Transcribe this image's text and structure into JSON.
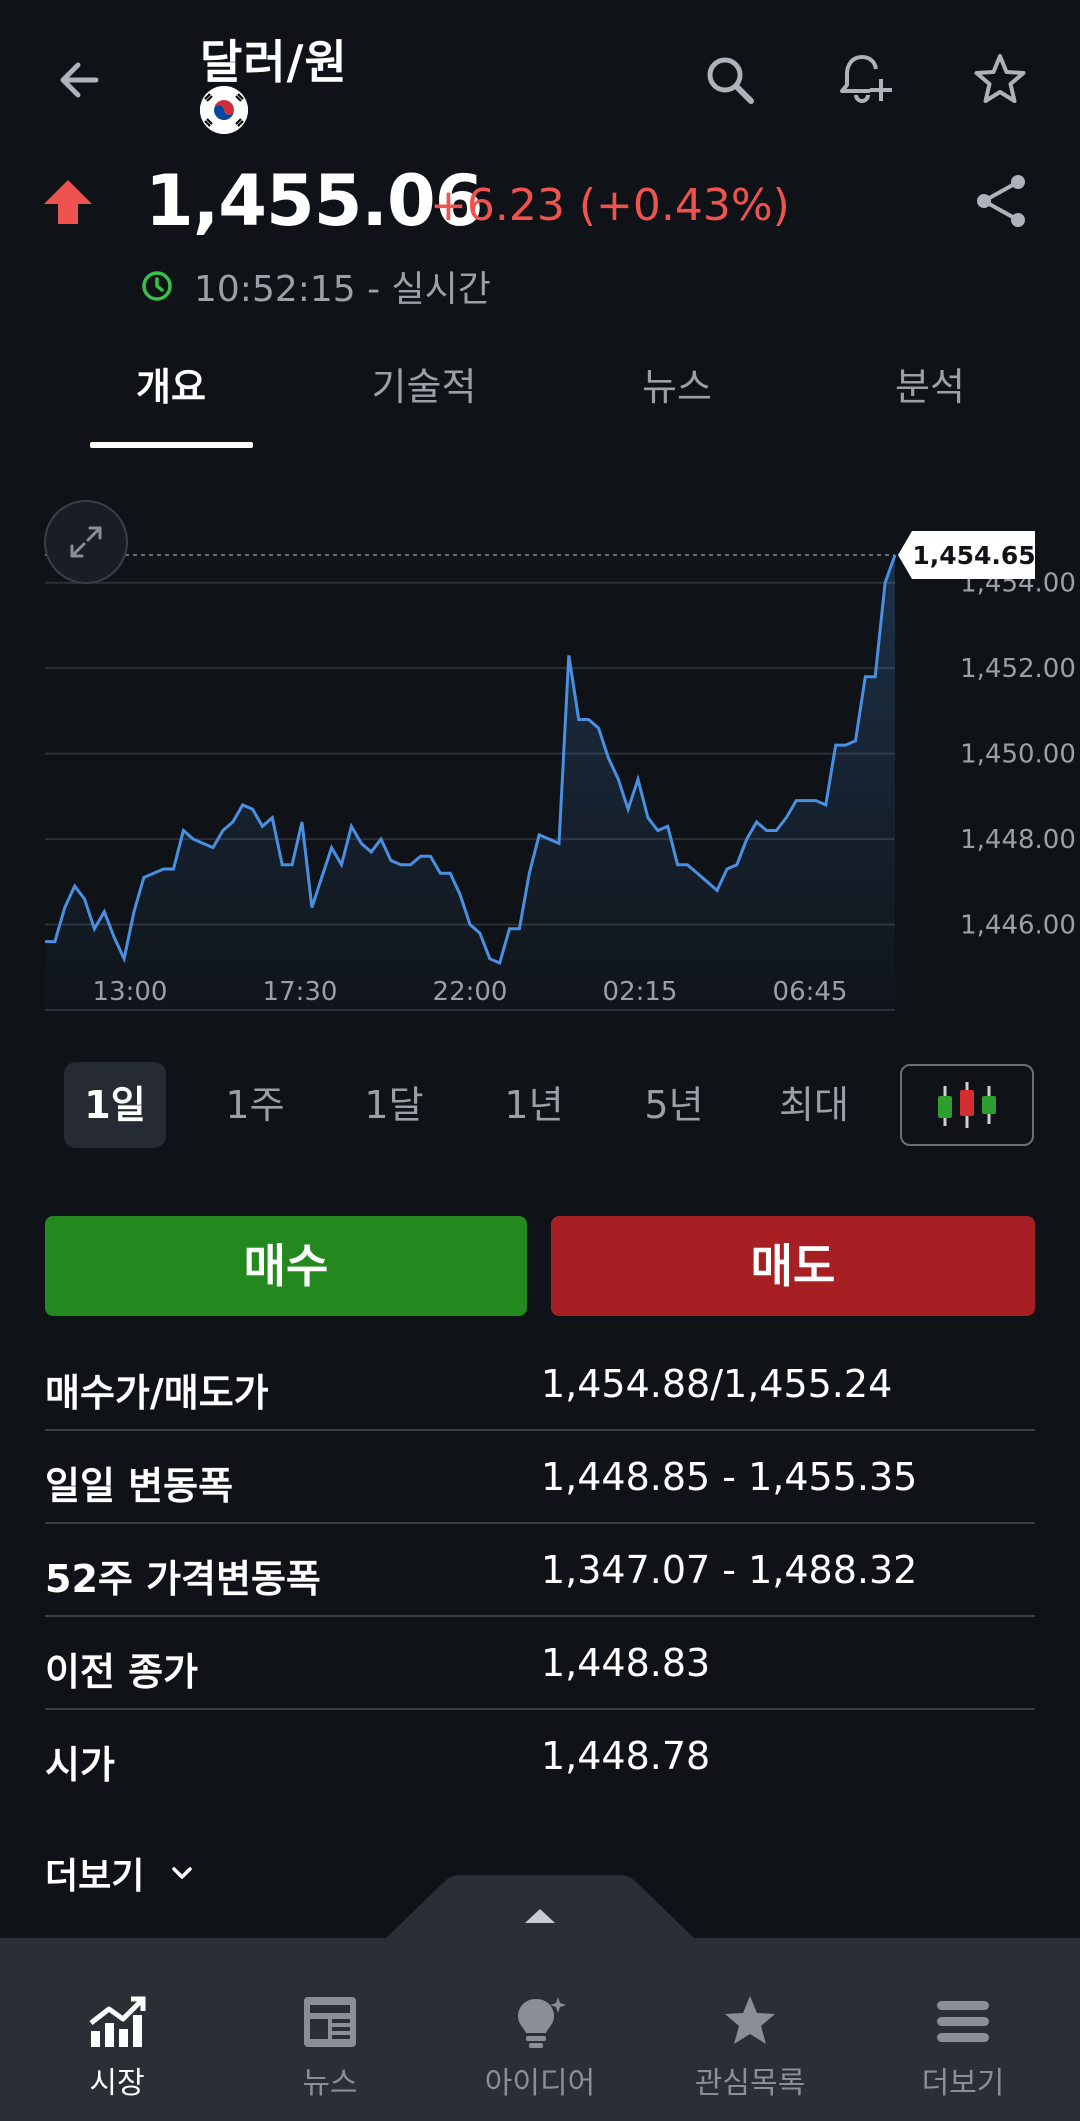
{
  "header": {
    "title": "달러/원",
    "price": "1,455.06",
    "change": "+6.23 (+0.43%)",
    "time": "10:52:15 - 실시간"
  },
  "tabs": [
    {
      "label": "개요",
      "active": true
    },
    {
      "label": "기술적",
      "active": false
    },
    {
      "label": "뉴스",
      "active": false
    },
    {
      "label": "분석",
      "active": false
    }
  ],
  "chart_data": {
    "type": "area",
    "current_value_label": "1,454.65",
    "x_ticks": [
      "13:00",
      "17:30",
      "22:00",
      "02:15",
      "06:45"
    ],
    "y_ticks": [
      "1,446.00",
      "1,448.00",
      "1,450.00",
      "1,452.00",
      "1,454.00"
    ],
    "ylim": [
      1444.0,
      1455.0
    ],
    "current_value": 1454.65,
    "line_color": "#4a90e2",
    "series": [
      {
        "values": [
          1445.6,
          1445.6,
          1446.4,
          1446.9,
          1446.6,
          1445.9,
          1446.3,
          1445.7,
          1445.2,
          1446.3,
          1447.1,
          1447.2,
          1447.3,
          1447.3,
          1448.2,
          1448.0,
          1447.9,
          1447.8,
          1448.2,
          1448.4,
          1448.8,
          1448.7,
          1448.3,
          1448.5,
          1447.4,
          1447.4,
          1448.4,
          1446.4,
          1447.1,
          1447.8,
          1447.4,
          1448.3,
          1447.9,
          1447.7,
          1448.0,
          1447.5,
          1447.4,
          1447.4,
          1447.6,
          1447.6,
          1447.2,
          1447.2,
          1446.7,
          1446.0,
          1445.8,
          1445.2,
          1445.1,
          1445.9,
          1445.9,
          1447.2,
          1448.1,
          1448.0,
          1447.9,
          1452.3,
          1450.8,
          1450.8,
          1450.6,
          1449.9,
          1449.4,
          1448.7,
          1449.4,
          1448.5,
          1448.2,
          1448.3,
          1447.4,
          1447.4,
          1447.2,
          1447.0,
          1446.8,
          1447.3,
          1447.4,
          1448.0,
          1448.4,
          1448.2,
          1448.2,
          1448.5,
          1448.9,
          1448.9,
          1448.9,
          1448.8,
          1450.2,
          1450.2,
          1450.3,
          1451.8,
          1451.8,
          1454.0,
          1454.65
        ]
      }
    ]
  },
  "ranges": [
    {
      "label": "1일",
      "active": true
    },
    {
      "label": "1주",
      "active": false
    },
    {
      "label": "1달",
      "active": false
    },
    {
      "label": "1년",
      "active": false
    },
    {
      "label": "5년",
      "active": false
    },
    {
      "label": "최대",
      "active": false
    }
  ],
  "actions": {
    "buy": "매수",
    "sell": "매도"
  },
  "stats": [
    {
      "label": "매수가/매도가",
      "value": "1,454.88/1,455.24"
    },
    {
      "label": "일일 변동폭",
      "value": "1,448.85 - 1,455.35"
    },
    {
      "label": "52주 가격변동폭",
      "value": "1,347.07 - 1,488.32"
    },
    {
      "label": "이전 종가",
      "value": "1,448.83"
    },
    {
      "label": "시가",
      "value": "1,448.78"
    }
  ],
  "more_label": "더보기",
  "bottom_nav": [
    {
      "label": "시장",
      "icon": "market-icon",
      "active": true
    },
    {
      "label": "뉴스",
      "icon": "news-icon",
      "active": false
    },
    {
      "label": "아이디어",
      "icon": "idea-icon",
      "active": false
    },
    {
      "label": "관심목록",
      "icon": "star-icon",
      "active": false
    },
    {
      "label": "더보기",
      "icon": "menu-icon",
      "active": false
    }
  ],
  "colors": {
    "background": "#0f1216",
    "up": "#ef5350",
    "buy": "#23891f",
    "sell": "#a81f23",
    "line": "#4a90e2",
    "live": "#35c246"
  }
}
